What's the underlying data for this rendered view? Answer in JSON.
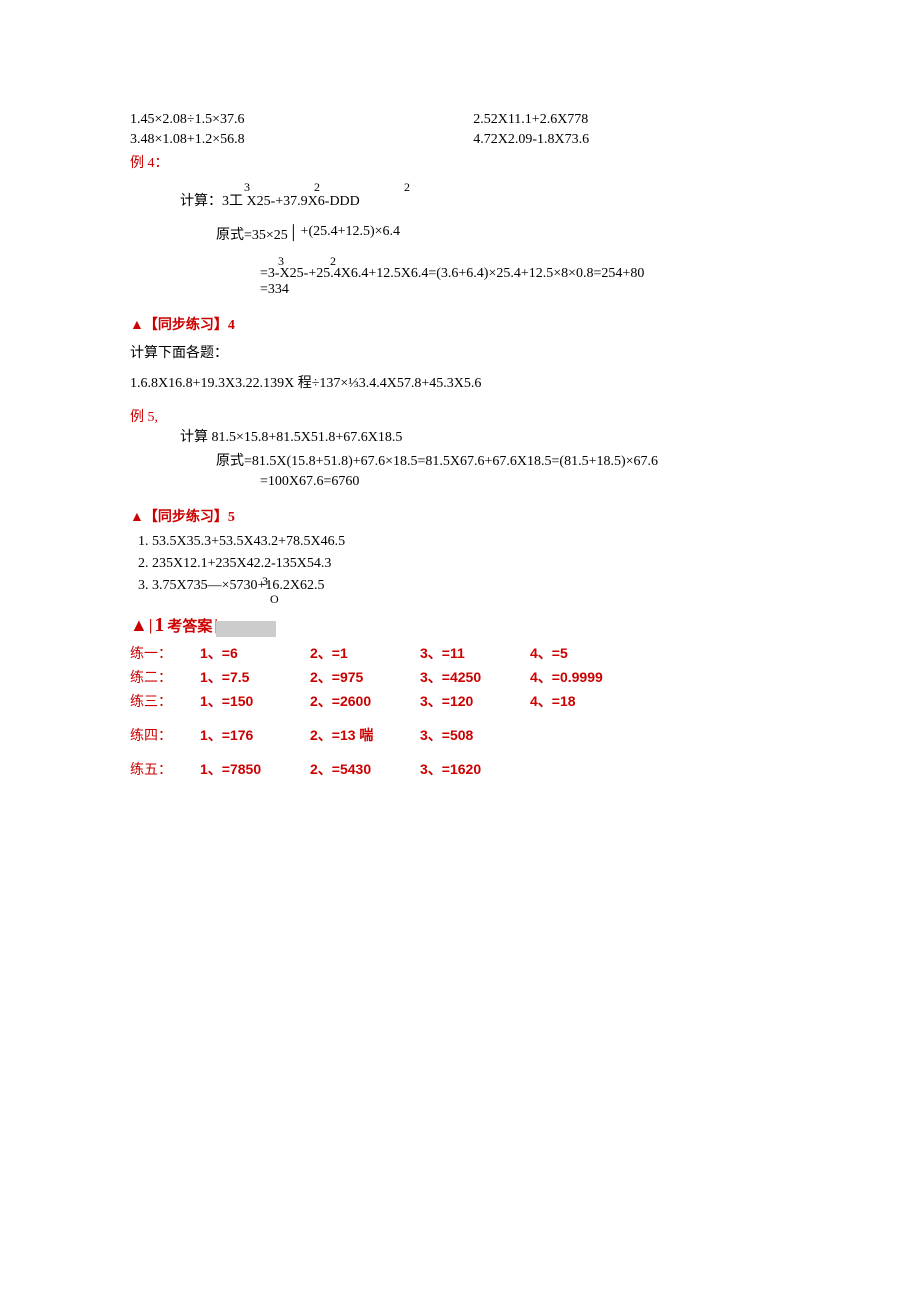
{
  "top": {
    "left1": "1.45×2.08÷1.5×37.6",
    "left2": "3.48×1.08+1.2×56.8",
    "right1": "2.52X11.1+2.6X778",
    "right2": "4.72X2.09-1.8X73.6"
  },
  "ex4": {
    "label": "例 4：",
    "calc_prefix": "计算：3",
    "calc_sup1": "3",
    "calc_mid1": "工 X25-+37.9X6-DDD",
    "calc_sup2": "2",
    "calc_sup3": "2",
    "line1_a": "原式=35×25",
    "line1_b": "+(25.4+12.5)×6.4",
    "sup_row_3": "3",
    "sup_row_2": "2",
    "line2": "=3-X25-+25.4X6.4+12.5X6.4=(3.6+6.4)×25.4+12.5×8×0.8=254+80",
    "line3": "=334"
  },
  "sync4": {
    "title": "▲【同步练习】4",
    "prompt": "计算下面各题：",
    "q": "1.6.8X16.8+19.3X3.22.139X 程÷137×⅓3.4.4X57.8+45.3X5.6"
  },
  "ex5": {
    "label": "例 5,",
    "calc": "计算 81.5×15.8+81.5X51.8+67.6X18.5",
    "line1": "原式=81.5X(15.8+51.8)+67.6×18.5=81.5X67.6+67.6X18.5=(81.5+18.5)×67.6",
    "line2": "=100X67.6=6760"
  },
  "sync5": {
    "title": "▲【同步练习】5",
    "items": [
      "53.5X35.3+53.5X43.2+78.5X46.5",
      "235X12.1+235X42.2-135X54.3",
      "3.75X735—×5730+16.2X62.5"
    ],
    "item3_sup": "3",
    "item3_sub": "O"
  },
  "answers": {
    "header": {
      "one": "1",
      "text": "考答案"
    },
    "rows": [
      {
        "label": "练一：",
        "cells": [
          "1、=6",
          "2、=1",
          "3、=11",
          "4、=5"
        ]
      },
      {
        "label": "练二：",
        "cells": [
          "1、=7.5",
          "2、=975",
          "3、=4250",
          "4、=0.9999"
        ]
      },
      {
        "label": "练三：",
        "cells": [
          "1、=150",
          "2、=2600",
          "3、=120",
          "4、=18"
        ]
      },
      {
        "label": "练四：",
        "cells": [
          "1、=176",
          "2、=13 喘",
          "3、=508",
          ""
        ]
      },
      {
        "label": "练五：",
        "cells": [
          "1、=7850",
          "2、=5430",
          "3、=1620",
          ""
        ]
      }
    ]
  }
}
